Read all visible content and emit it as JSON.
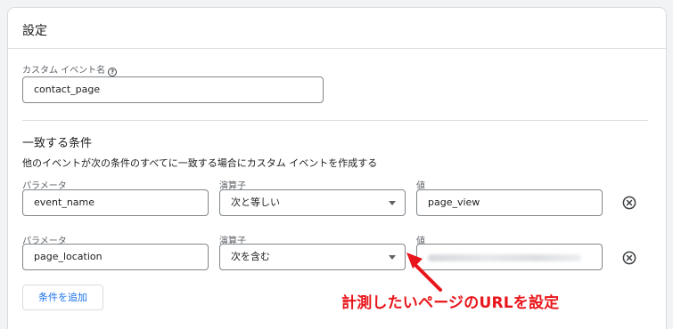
{
  "card": {
    "title": "設定"
  },
  "custom_event_name": {
    "label": "カスタム イベント名",
    "help_icon": "help-circle-icon",
    "value": "contact_page"
  },
  "conditions": {
    "title": "一致する条件",
    "description": "他のイベントが次の条件のすべてに一致する場合にカスタム イベントを作成する",
    "rows": [
      {
        "param_label": "パラメータ",
        "param_value": "event_name",
        "operator_label": "演算子",
        "operator_value": "次と等しい",
        "value_label": "値",
        "value": "page_view",
        "remove_icon": "remove-circle-icon"
      },
      {
        "param_label": "パラメータ",
        "param_value": "page_location",
        "operator_label": "演算子",
        "operator_value": "次を含む",
        "value_label": "値",
        "value_blurred": true,
        "remove_icon": "remove-circle-icon"
      }
    ],
    "add_button": "条件を追加"
  },
  "annotation": {
    "text": "計測したいページのURLを設定",
    "color": "#e8161b"
  },
  "colors": {
    "accent": "#1a73e8",
    "annotation": "#e8161b"
  }
}
